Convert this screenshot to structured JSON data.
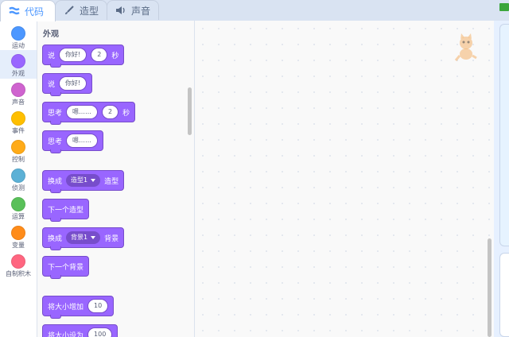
{
  "tabs": [
    {
      "label": "代码",
      "icon": "code-icon",
      "active": true
    },
    {
      "label": "造型",
      "icon": "brush-icon",
      "active": false
    },
    {
      "label": "声音",
      "icon": "speaker-icon",
      "active": false
    }
  ],
  "categories": [
    {
      "label": "运动",
      "color": "#4c97ff"
    },
    {
      "label": "外观",
      "color": "#9966ff"
    },
    {
      "label": "声音",
      "color": "#cf63cf"
    },
    {
      "label": "事件",
      "color": "#ffbf00"
    },
    {
      "label": "控制",
      "color": "#ffab19"
    },
    {
      "label": "侦测",
      "color": "#5cb1d6"
    },
    {
      "label": "运算",
      "color": "#59c059"
    },
    {
      "label": "变量",
      "color": "#ff8c1a"
    },
    {
      "label": "自制积木",
      "color": "#ff6680"
    }
  ],
  "palette": {
    "heading": "外观",
    "blocks": {
      "say_secs": {
        "say": "说",
        "text": "你好!",
        "secs": "2",
        "unit": "秒"
      },
      "say": {
        "say": "说",
        "text": "你好!"
      },
      "think_secs": {
        "think": "思考",
        "text": "嗯……",
        "secs": "2",
        "unit": "秒"
      },
      "think": {
        "think": "思考",
        "text": "嗯……"
      },
      "switch_costume": {
        "prefix": "换成",
        "value": "造型1",
        "suffix": "造型"
      },
      "next_costume": {
        "label": "下一个造型"
      },
      "switch_backdrop": {
        "prefix": "换成",
        "value": "背景1",
        "suffix": "背景"
      },
      "next_backdrop": {
        "label": "下一个背景"
      },
      "change_size": {
        "label": "将大小增加",
        "value": "10"
      },
      "set_size": {
        "label": "将大小设为",
        "value": "100"
      }
    }
  }
}
